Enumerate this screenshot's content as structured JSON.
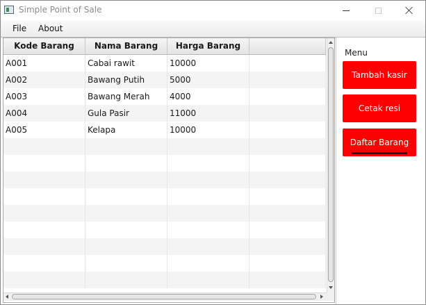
{
  "window": {
    "title": "Simple Point of Sale"
  },
  "menu": {
    "items": [
      {
        "label": "File"
      },
      {
        "label": "About"
      }
    ]
  },
  "table": {
    "columns": [
      "Kode Barang",
      "Nama Barang",
      "Harga Barang",
      ""
    ],
    "rows": [
      [
        "A001",
        "Cabai rawit",
        "10000"
      ],
      [
        "A002",
        "Bawang Putih",
        "5000"
      ],
      [
        "A003",
        "Bawang Merah",
        "4000"
      ],
      [
        "A004",
        "Gula Pasir",
        "11000"
      ],
      [
        "A005",
        "Kelapa",
        "10000"
      ]
    ],
    "empty_row_count": 9
  },
  "side_menu": {
    "label": "Menu",
    "buttons": [
      {
        "label": "Tambah kasir"
      },
      {
        "label": "Cetak resi"
      },
      {
        "label": "Daftar Barang"
      }
    ],
    "accent_color": "#ff0000"
  },
  "icons": {
    "app": "window-app-icon",
    "minimize": "minimize-icon",
    "maximize": "maximize-icon",
    "close": "close-icon"
  }
}
